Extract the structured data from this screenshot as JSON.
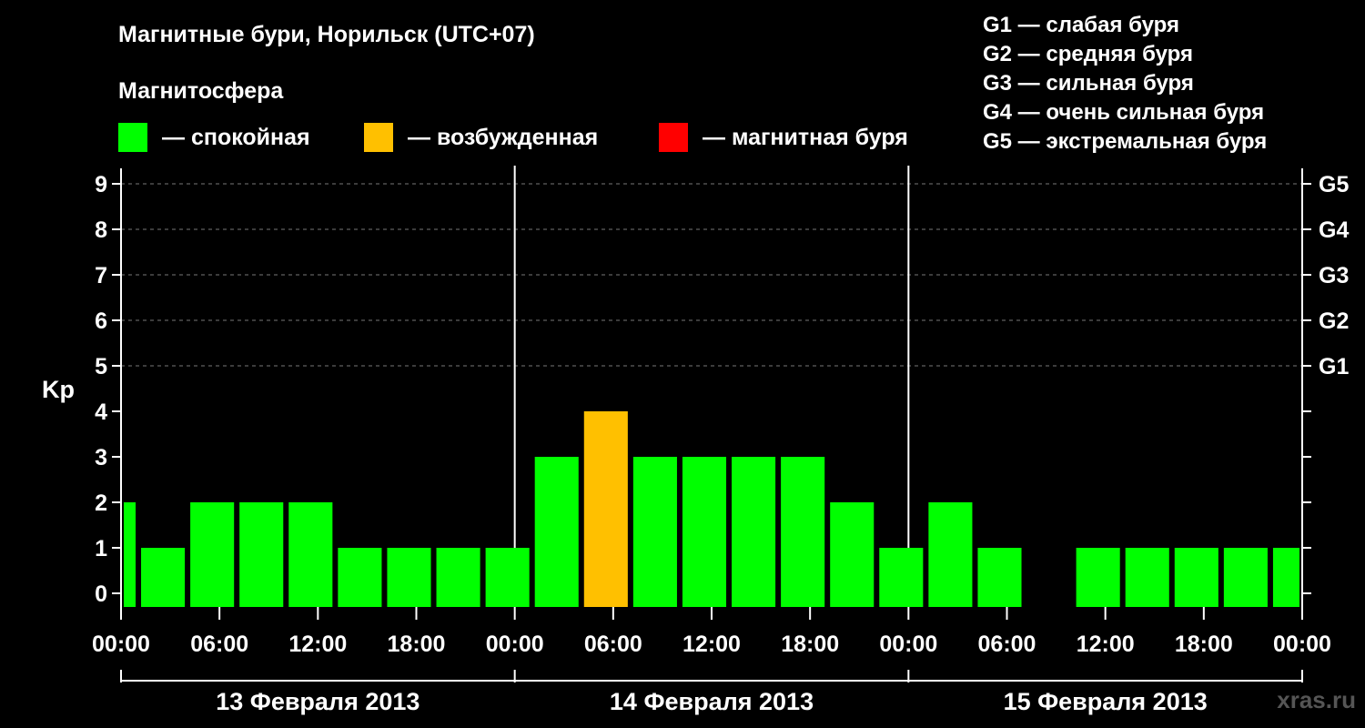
{
  "header": {
    "title": "Магнитные бури, Норильск (UTC+07)",
    "magnetosphere_label": "Магнитосфера"
  },
  "legend": {
    "items": [
      {
        "label": "— спокойная",
        "color": "#00ff00"
      },
      {
        "label": "— возбужденная",
        "color": "#ffc000"
      },
      {
        "label": "— магнитная буря",
        "color": "#ff0000"
      }
    ]
  },
  "g_scale": [
    "G1 — слабая буря",
    "G2 — средняя буря",
    "G3 — сильная буря",
    "G4 — очень сильная буря",
    "G5 — экстремальная буря"
  ],
  "watermark": "xras.ru",
  "chart_data": {
    "type": "bar",
    "ylabel": "Kp",
    "ylim": [
      0,
      9
    ],
    "yticks": [
      0,
      1,
      2,
      3,
      4,
      5,
      6,
      7,
      8,
      9
    ],
    "right_ticks": [
      {
        "value": 5,
        "label": "G1"
      },
      {
        "value": 6,
        "label": "G2"
      },
      {
        "value": 7,
        "label": "G3"
      },
      {
        "value": 8,
        "label": "G4"
      },
      {
        "value": 9,
        "label": "G5"
      }
    ],
    "xlim_hours": [
      0,
      72
    ],
    "xtick_labels": [
      "00:00",
      "06:00",
      "12:00",
      "18:00",
      "00:00",
      "06:00",
      "12:00",
      "18:00",
      "00:00",
      "06:00",
      "12:00",
      "18:00",
      "00:00"
    ],
    "days": [
      "13 Февраля 2013",
      "14 Февраля 2013",
      "15 Февраля 2013"
    ],
    "grid": "dashed at 5–9",
    "bars": [
      {
        "start": "00:00",
        "end": "01:00",
        "day": "13 Февраля 2013",
        "kp": 2,
        "status": "спокойная",
        "color": "#00ff00"
      },
      {
        "start": "01:00",
        "end": "04:00",
        "day": "13 Февраля 2013",
        "kp": 1,
        "status": "спокойная",
        "color": "#00ff00"
      },
      {
        "start": "04:00",
        "end": "07:00",
        "day": "13 Февраля 2013",
        "kp": 2,
        "status": "спокойная",
        "color": "#00ff00"
      },
      {
        "start": "07:00",
        "end": "10:00",
        "day": "13 Февраля 2013",
        "kp": 2,
        "status": "спокойная",
        "color": "#00ff00"
      },
      {
        "start": "10:00",
        "end": "13:00",
        "day": "13 Февраля 2013",
        "kp": 2,
        "status": "спокойная",
        "color": "#00ff00"
      },
      {
        "start": "13:00",
        "end": "16:00",
        "day": "13 Февраля 2013",
        "kp": 1,
        "status": "спокойная",
        "color": "#00ff00"
      },
      {
        "start": "16:00",
        "end": "19:00",
        "day": "13 Февраля 2013",
        "kp": 1,
        "status": "спокойная",
        "color": "#00ff00"
      },
      {
        "start": "19:00",
        "end": "22:00",
        "day": "13 Февраля 2013",
        "kp": 1,
        "status": "спокойная",
        "color": "#00ff00"
      },
      {
        "start": "22:00",
        "end": "01:00",
        "day": "13 Февраля 2013",
        "kp": 1,
        "status": "спокойная",
        "color": "#00ff00"
      },
      {
        "start": "01:00",
        "end": "04:00",
        "day": "14 Февраля 2013",
        "kp": 3,
        "status": "спокойная",
        "color": "#00ff00"
      },
      {
        "start": "04:00",
        "end": "07:00",
        "day": "14 Февраля 2013",
        "kp": 4,
        "status": "возбужденная",
        "color": "#ffc000"
      },
      {
        "start": "07:00",
        "end": "10:00",
        "day": "14 Февраля 2013",
        "kp": 3,
        "status": "спокойная",
        "color": "#00ff00"
      },
      {
        "start": "10:00",
        "end": "13:00",
        "day": "14 Февраля 2013",
        "kp": 3,
        "status": "спокойная",
        "color": "#00ff00"
      },
      {
        "start": "13:00",
        "end": "16:00",
        "day": "14 Февраля 2013",
        "kp": 3,
        "status": "спокойная",
        "color": "#00ff00"
      },
      {
        "start": "16:00",
        "end": "19:00",
        "day": "14 Февраля 2013",
        "kp": 3,
        "status": "спокойная",
        "color": "#00ff00"
      },
      {
        "start": "19:00",
        "end": "22:00",
        "day": "14 Февраля 2013",
        "kp": 2,
        "status": "спокойная",
        "color": "#00ff00"
      },
      {
        "start": "22:00",
        "end": "01:00",
        "day": "14 Февраля 2013",
        "kp": 1,
        "status": "спокойная",
        "color": "#00ff00"
      },
      {
        "start": "01:00",
        "end": "04:00",
        "day": "15 Февраля 2013",
        "kp": 2,
        "status": "спокойная",
        "color": "#00ff00"
      },
      {
        "start": "04:00",
        "end": "07:00",
        "day": "15 Февраля 2013",
        "kp": 1,
        "status": "спокойная",
        "color": "#00ff00"
      },
      {
        "start": "07:00",
        "end": "10:00",
        "day": "15 Февраля 2013",
        "kp": 0,
        "status": "спокойная",
        "color": "#00ff00"
      },
      {
        "start": "10:00",
        "end": "13:00",
        "day": "15 Февраля 2013",
        "kp": 1,
        "status": "спокойная",
        "color": "#00ff00"
      },
      {
        "start": "13:00",
        "end": "16:00",
        "day": "15 Февраля 2013",
        "kp": 1,
        "status": "спокойная",
        "color": "#00ff00"
      },
      {
        "start": "16:00",
        "end": "19:00",
        "day": "15 Февраля 2013",
        "kp": 1,
        "status": "спокойная",
        "color": "#00ff00"
      },
      {
        "start": "19:00",
        "end": "22:00",
        "day": "15 Февраля 2013",
        "kp": 1,
        "status": "спокойная",
        "color": "#00ff00"
      },
      {
        "start": "22:00",
        "end": "00:00",
        "day": "15 Февраля 2013",
        "kp": 1,
        "status": "спокойная",
        "color": "#00ff00"
      }
    ]
  }
}
